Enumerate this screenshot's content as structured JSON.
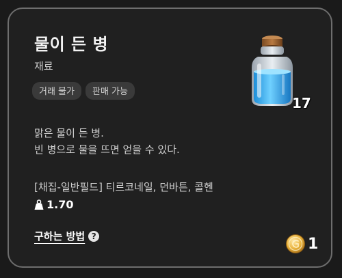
{
  "item": {
    "name": "물이 든 병",
    "category": "재료",
    "tags": [
      "거래 불가",
      "판매 가능"
    ],
    "count": "17",
    "icon": "water-bottle-icon",
    "description": [
      "맑은 물이 든 병.",
      "빈 병으로 물을 뜨면 얻을 수 있다."
    ],
    "source": "[채집-일반필드] 티르코네일, 던바튼, 콜헨",
    "weight": "1.70",
    "how_to_obtain_label": "구하는 방법",
    "price": "1"
  },
  "colors": {
    "border": "#6e6e6e",
    "background": "#202020",
    "tag_background": "#3a3a3a",
    "water": "#3fb4f0",
    "coin": "#e8b13a"
  }
}
